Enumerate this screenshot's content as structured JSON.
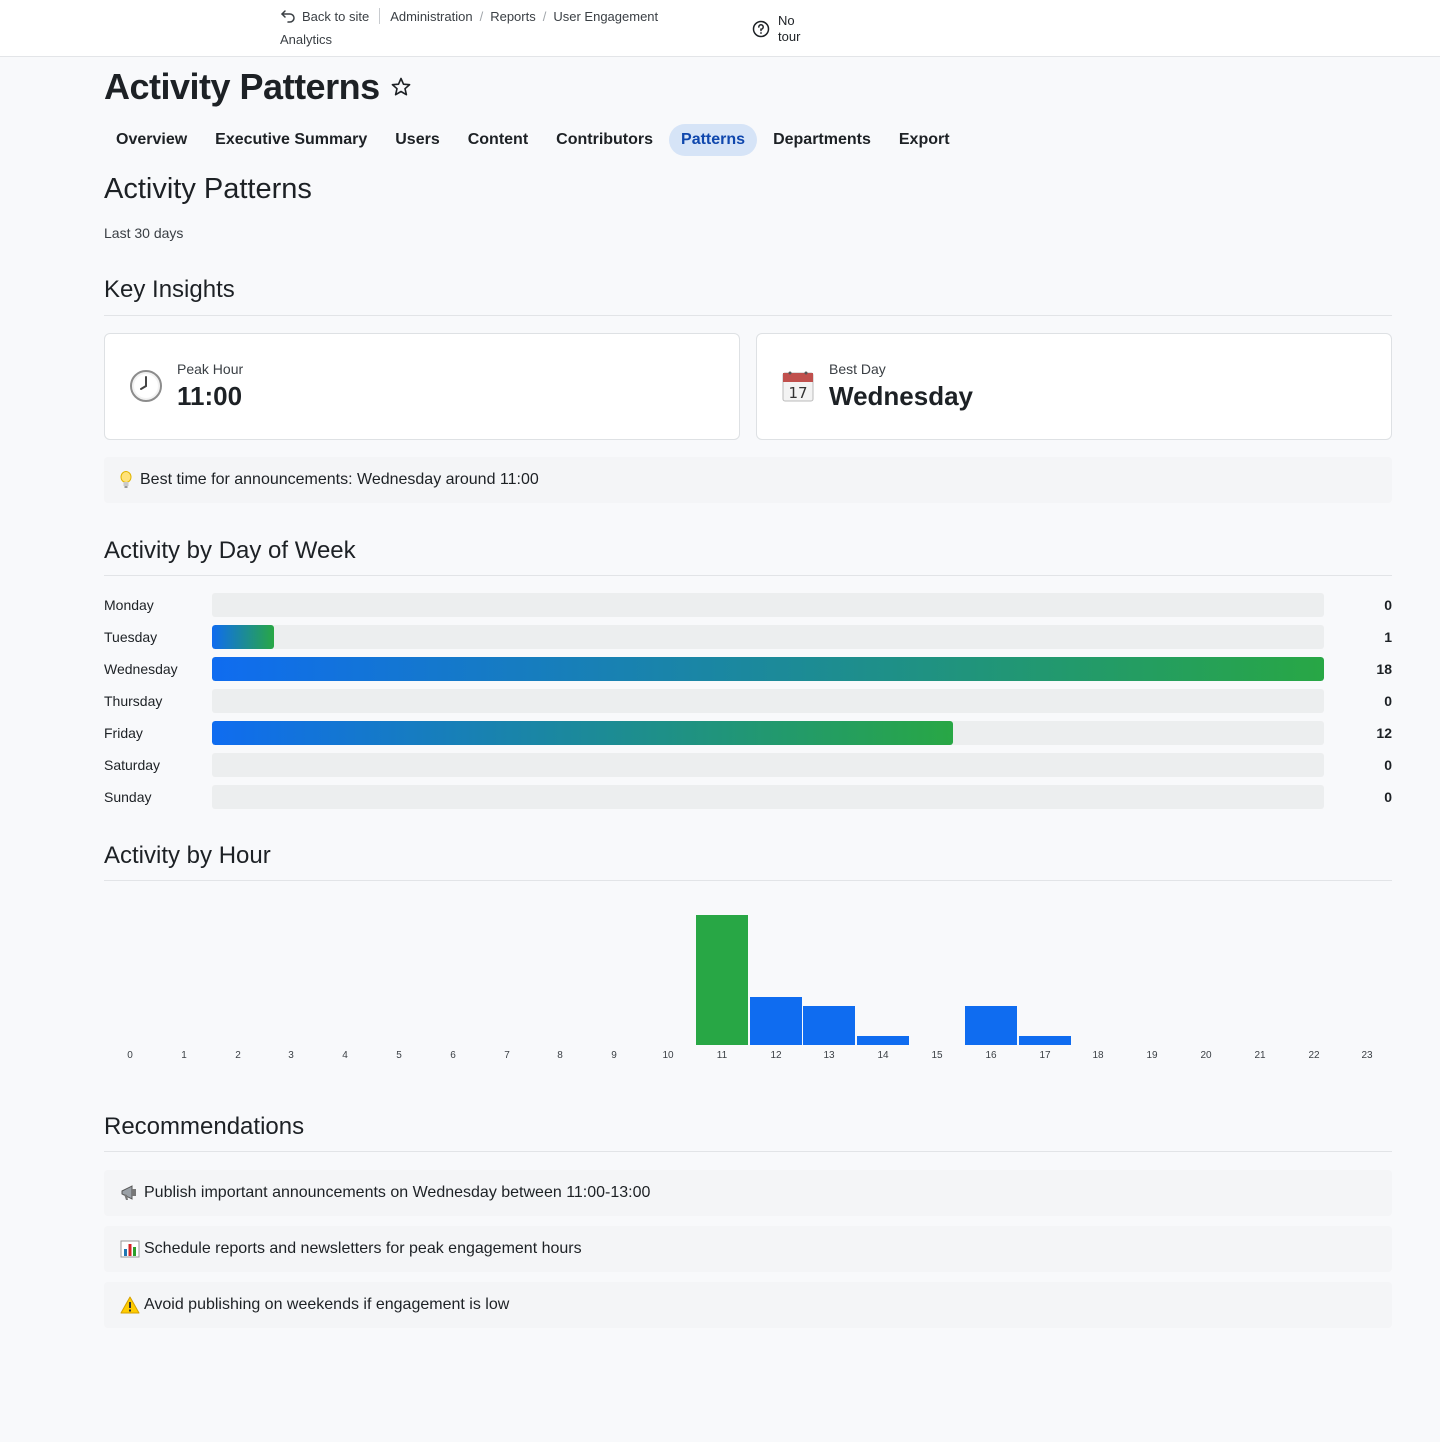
{
  "header": {
    "back_label": "Back to site",
    "breadcrumbs": [
      "Administration",
      "Reports",
      "User Engagement"
    ],
    "breadcrumb_tail": "Analytics",
    "tour_label": "No tour"
  },
  "page": {
    "title": "Activity Patterns"
  },
  "tabs": [
    {
      "label": "Overview",
      "active": false
    },
    {
      "label": "Executive Summary",
      "active": false
    },
    {
      "label": "Users",
      "active": false
    },
    {
      "label": "Content",
      "active": false
    },
    {
      "label": "Contributors",
      "active": false
    },
    {
      "label": "Patterns",
      "active": true
    },
    {
      "label": "Departments",
      "active": false
    },
    {
      "label": "Export",
      "active": false
    }
  ],
  "main": {
    "heading": "Activity Patterns",
    "period": "Last 30 days",
    "key_insights_title": "Key Insights",
    "peak_hour": {
      "label": "Peak Hour",
      "value": "11:00",
      "icon": "clock-icon"
    },
    "best_day": {
      "label": "Best Day",
      "value": "Wednesday",
      "icon": "calendar-icon"
    },
    "tip": "Best time for announcements: Wednesday around 11:00",
    "day_section_title": "Activity by Day of Week",
    "hour_section_title": "Activity by Hour",
    "recommendations_title": "Recommendations",
    "recommendations": [
      {
        "icon": "megaphone-icon",
        "text": "Publish important announcements on Wednesday between 11:00-13:00"
      },
      {
        "icon": "bar-chart-icon",
        "text": "Schedule reports and newsletters for peak engagement hours"
      },
      {
        "icon": "warning-icon",
        "text": "Avoid publishing on weekends if engagement is low"
      }
    ]
  },
  "colors": {
    "bar_gradient_start": "#0f6cf0",
    "bar_gradient_end": "#28a745",
    "hour_bar": "#0f6cf0",
    "hour_peak_bar": "#28a745",
    "active_tab_bg": "#d6e4f7",
    "active_tab_text": "#0f47ad"
  },
  "chart_data": [
    {
      "type": "bar",
      "orientation": "horizontal",
      "categories": [
        "Monday",
        "Tuesday",
        "Wednesday",
        "Thursday",
        "Friday",
        "Saturday",
        "Sunday"
      ],
      "values": [
        0,
        1,
        18,
        0,
        12,
        0,
        0
      ],
      "xlim": [
        0,
        18
      ]
    },
    {
      "type": "bar",
      "categories": [
        "0",
        "1",
        "2",
        "3",
        "4",
        "5",
        "6",
        "7",
        "8",
        "9",
        "10",
        "11",
        "12",
        "13",
        "14",
        "15",
        "16",
        "17",
        "18",
        "19",
        "20",
        "21",
        "22",
        "23"
      ],
      "values": [
        0,
        0,
        0,
        0,
        0,
        0,
        0,
        0,
        0,
        0,
        0,
        15,
        5.5,
        4.5,
        1,
        0,
        4.5,
        1,
        0,
        0,
        0,
        0,
        0,
        0
      ],
      "highlight_category": "11",
      "ylim": [
        0,
        15
      ]
    }
  ]
}
